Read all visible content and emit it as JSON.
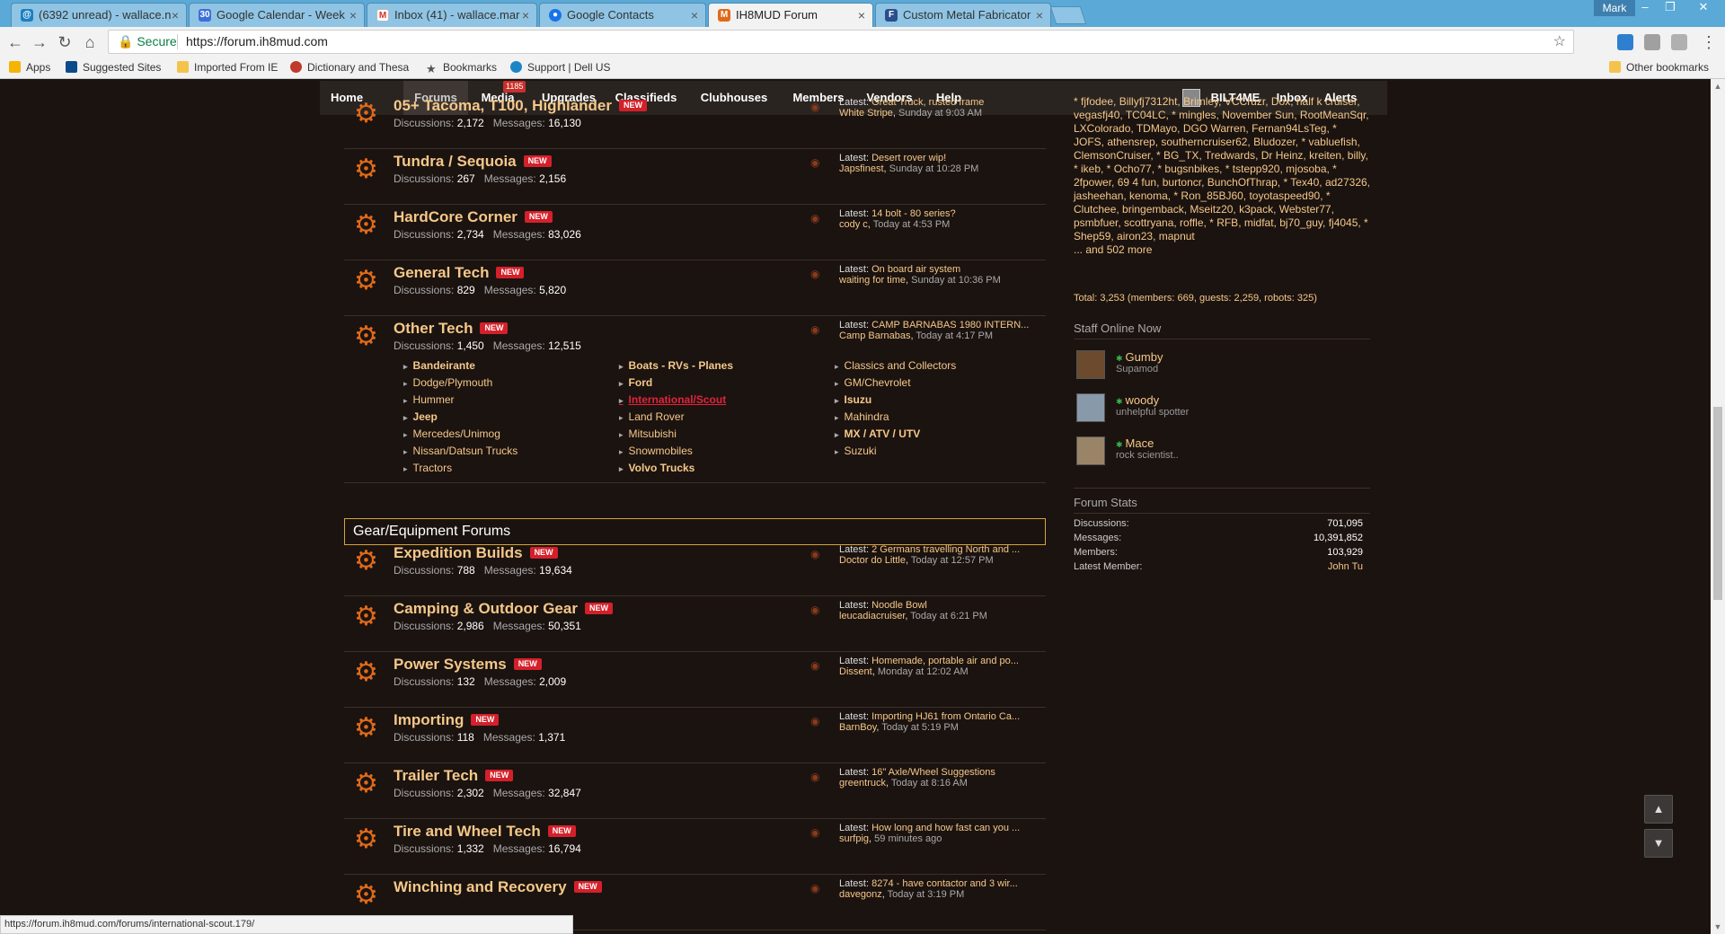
{
  "browser": {
    "tabs": [
      {
        "title": "(6392 unread) - wallace.n",
        "icon": "at-t-icon"
      },
      {
        "title": "Google Calendar - Week",
        "icon": "calendar-icon"
      },
      {
        "title": "Inbox (41) - wallace.mar",
        "icon": "gmail-icon"
      },
      {
        "title": "Google Contacts",
        "icon": "contacts-icon"
      },
      {
        "title": "IH8MUD Forum",
        "icon": "ih8mud-icon"
      },
      {
        "title": "Custom Metal Fabricator",
        "icon": "fabricator-icon"
      }
    ],
    "active_tab": 4,
    "window_user": "Mark",
    "secure_label": "Secure",
    "url": "https://forum.ih8mud.com",
    "bookmarks": [
      "Apps",
      "Suggested Sites",
      "Imported From IE",
      "Dictionary and Thesa",
      "Bookmarks",
      "Support | Dell US",
      "Other bookmarks"
    ],
    "status_url": "https://forum.ih8mud.com/forums/international-scout.179/"
  },
  "nav": {
    "items": [
      "Home",
      "Forums",
      "Media",
      "Upgrades",
      "Classifieds",
      "Clubhouses",
      "Members",
      "Vendors",
      "Help"
    ],
    "active": "Forums",
    "media_badge": "1185",
    "username": "BILT4ME",
    "inbox": "Inbox",
    "alerts": "Alerts"
  },
  "labels": {
    "discussions": "Discussions:",
    "messages": "Messages:",
    "latest": "Latest:",
    "new_badge": "NEW"
  },
  "forums_top": [
    {
      "title": "05+ Tacoma, T100, Highlander",
      "discussions": "2,172",
      "messages": "16,130",
      "latest_title": "Great Truck, rusted frame",
      "latest_user": "White Stripe",
      "latest_date": "Sunday at 9:03 AM"
    },
    {
      "title": "Tundra / Sequoia",
      "discussions": "267",
      "messages": "2,156",
      "latest_title": "Desert rover wip!",
      "latest_user": "Japsfinest",
      "latest_date": "Sunday at 10:28 PM"
    },
    {
      "title": "HardCore Corner",
      "discussions": "2,734",
      "messages": "83,026",
      "latest_title": "14 bolt - 80 series?",
      "latest_user": "cody c",
      "latest_date": "Today at 4:53 PM"
    },
    {
      "title": "General Tech",
      "discussions": "829",
      "messages": "5,820",
      "latest_title": "On board air system",
      "latest_user": "waiting for time",
      "latest_date": "Sunday at 10:36 PM"
    },
    {
      "title": "Other Tech",
      "discussions": "1,450",
      "messages": "12,515",
      "latest_title": "CAMP BARNABAS 1980 INTERN...",
      "latest_user": "Camp Barnabas",
      "latest_date": "Today at 4:17 PM"
    }
  ],
  "other_tech_subforums": [
    [
      "Bandeirante",
      "Dodge/Plymouth",
      "Hummer",
      "Jeep",
      "Mercedes/Unimog",
      "Nissan/Datsun Trucks",
      "Tractors"
    ],
    [
      "Boats - RVs - Planes",
      "Ford",
      "International/Scout",
      "Land Rover",
      "Mitsubishi",
      "Snowmobiles",
      "Volvo Trucks"
    ],
    [
      "Classics and Collectors",
      "GM/Chevrolet",
      "Isuzu",
      "Mahindra",
      "MX / ATV / UTV",
      "Suzuki"
    ]
  ],
  "category_title": "Gear/Equipment Forums",
  "forums_gear": [
    {
      "title": "Expedition Builds",
      "discussions": "788",
      "messages": "19,634",
      "latest_title": "2 Germans travelling North and ...",
      "latest_user": "Doctor do Little",
      "latest_date": "Today at 12:57 PM"
    },
    {
      "title": "Camping & Outdoor Gear",
      "discussions": "2,986",
      "messages": "50,351",
      "latest_title": "Noodle Bowl",
      "latest_user": "leucadiacruiser",
      "latest_date": "Today at 6:21 PM"
    },
    {
      "title": "Power Systems",
      "discussions": "132",
      "messages": "2,009",
      "latest_title": "Homemade, portable air and po...",
      "latest_user": "Dissent",
      "latest_date": "Monday at 12:02 AM"
    },
    {
      "title": "Importing",
      "discussions": "118",
      "messages": "1,371",
      "latest_title": "Importing HJ61 from Ontario Ca...",
      "latest_user": "BarnBoy",
      "latest_date": "Today at 5:19 PM"
    },
    {
      "title": "Trailer Tech",
      "discussions": "2,302",
      "messages": "32,847",
      "latest_title": "16\" Axle/Wheel Suggestions",
      "latest_user": "greentruck",
      "latest_date": "Today at 8:16 AM"
    },
    {
      "title": "Tire and Wheel Tech",
      "discussions": "1,332",
      "messages": "16,794",
      "latest_title": "How long and how fast can you ...",
      "latest_user": "surfpig",
      "latest_date": "59 minutes ago"
    },
    {
      "title": "Winching and Recovery",
      "discussions": "",
      "messages": "",
      "latest_title": "8274 - have contactor and 3 wir...",
      "latest_user": "davegonz",
      "latest_date": "Today at 3:19 PM"
    }
  ],
  "sidebar": {
    "online_names": "* fjfodee, Billyfj7312ht, Brimley, VCCruzr, Dox, half k cruiser, vegasfj40, TC04LC, * mingles, November Sun, RootMeanSqr, LXColorado, TDMayo, DGO Warren, Fernan94LsTeg, * JOFS, athensrep, southerncruiser62, Bludozer, * vabluefish, ClemsonCruiser, * BG_TX, Tredwards, Dr Heinz, kreiten, billy, * ikeb, * Ocho77, * bugsnbikes, * tstepp920, mjosoba, * 2fpower, 69 4 fun, burtoncr, BunchOfThrap, * Tex40, ad27326, jasheehan, kenoma, * Ron_85BJ60, toyotaspeed90, * Clutchee, bringemback, Mseitz20, k3pack, Webster77, psmbfuer, scottryana, roffle, * RFB, midfat, bj70_guy, fj4045, * Shep59, airon23, mapnut",
    "more": "... and 502 more",
    "total": "Total: 3,253 (members: 669, guests: 2,259, robots: 325)",
    "staff_title": "Staff Online Now",
    "staff": [
      {
        "name": "Gumby",
        "title": "Supamod"
      },
      {
        "name": "woody",
        "title": "unhelpful spotter"
      },
      {
        "name": "Mace",
        "title": "rock scientist.."
      }
    ],
    "stats_title": "Forum Stats",
    "stats": [
      {
        "label": "Discussions:",
        "value": "701,095"
      },
      {
        "label": "Messages:",
        "value": "10,391,852"
      },
      {
        "label": "Members:",
        "value": "103,929"
      },
      {
        "label": "Latest Member:",
        "value": "John Tu"
      }
    ]
  },
  "colors": {
    "accent": "#f5c889",
    "icon": "#e06a1a",
    "new_badge": "#d4202a",
    "page_bg": "#1b1310",
    "navbar": "#2a2421"
  }
}
